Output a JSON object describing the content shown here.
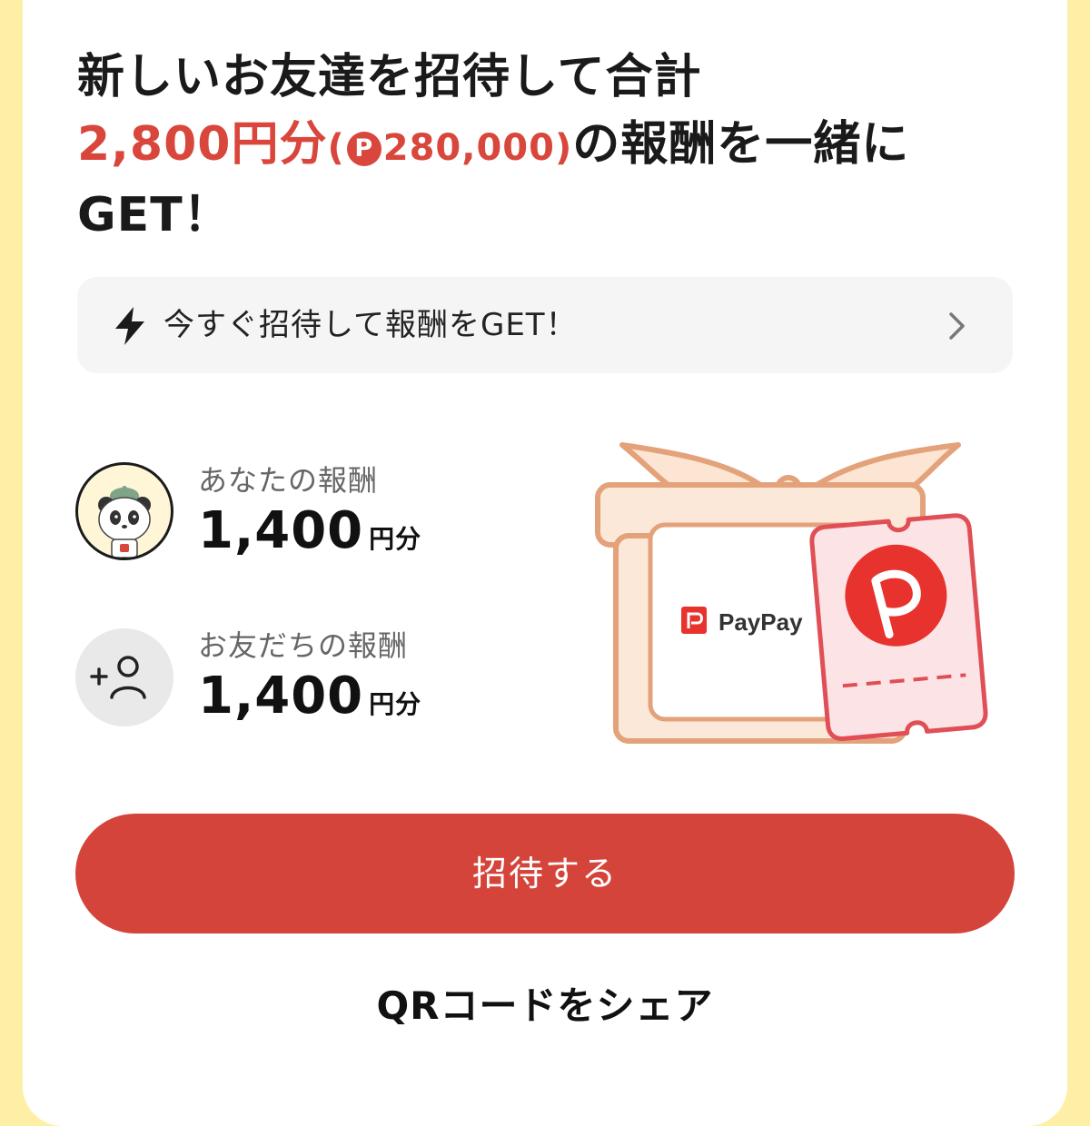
{
  "headline": {
    "line1": "新しいお友達を招待して合計",
    "amount": "2,800円分",
    "paren_open": "(",
    "point_icon": "P",
    "points": "280,000",
    "paren_close": ")",
    "line2_rest": "の報酬を一緒に",
    "line3": "GET！"
  },
  "banner": {
    "icon": "lightning-bolt-icon",
    "text": "今すぐ招待して報酬をGET！",
    "chevron": "chevron-right-icon"
  },
  "rewards": [
    {
      "label": "あなたの報酬",
      "amount": "1,400",
      "unit": "円分",
      "avatar": "panda-avatar-icon"
    },
    {
      "label": "お友だちの報酬",
      "amount": "1,400",
      "unit": "円分",
      "avatar": "add-friend-icon"
    }
  ],
  "gift": {
    "brand": "PayPay",
    "logo_letter": "P"
  },
  "cta": {
    "label": "招待する"
  },
  "share": {
    "label": "QRコードをシェア"
  },
  "colors": {
    "background": "#fdf0a6",
    "accent": "#d5443a",
    "banner_bg": "#f5f5f5"
  }
}
